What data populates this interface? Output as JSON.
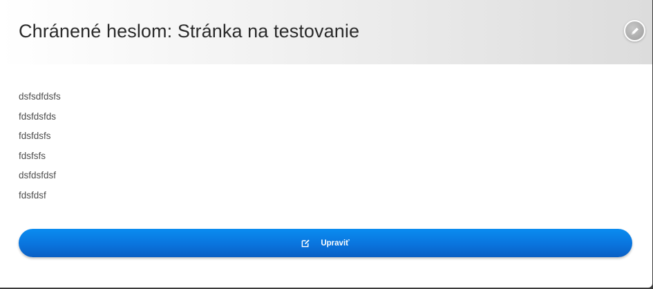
{
  "page": {
    "title": "Chránené heslom: Stránka na testovanie"
  },
  "header": {
    "edit_icon": "pencil-icon"
  },
  "content": {
    "lines": [
      "dsfsdfdsfs",
      "fdsfdsfds",
      "fdsfdsfs",
      "fdsfsfs",
      "dsfdsfdsf",
      "fdsfdsf"
    ]
  },
  "actions": {
    "edit_label": "Upraviť",
    "edit_icon": "edit-square-icon"
  },
  "colors": {
    "button": "#0a74dd",
    "button_text": "#ffffff",
    "title": "#2a2a2a",
    "body_text": "#4d4d4d"
  }
}
